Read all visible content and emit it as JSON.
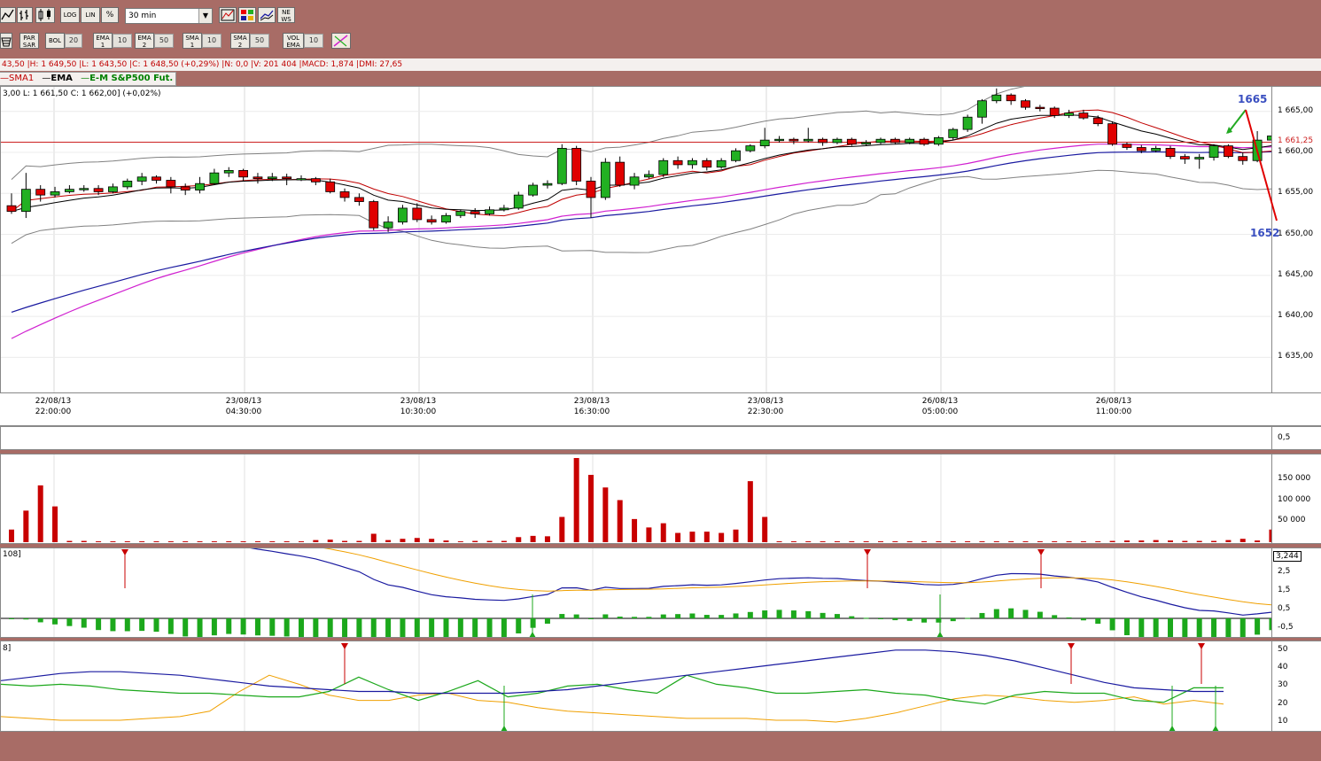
{
  "toolbar1": {
    "log_label": "LOG",
    "lin_label": "LIN",
    "pct_label": "%",
    "timeframe": "30 min",
    "news_label": "NE WS"
  },
  "toolbar2": {
    "parsar_label": "PAR SAR",
    "bol_label": "BOL",
    "bol_value": "20",
    "ema1_label": "EMA 1",
    "ema1_value": "10",
    "ema2_label": "EMA 2",
    "ema2_value": "50",
    "sma1_label": "SMA 1",
    "sma1_value": "10",
    "sma2_label": "SMA 2",
    "sma2_value": "50",
    "volema_label": "VOL EMA",
    "volema_value": "10"
  },
  "info_line": "43,50 |H: 1 649,50 |L: 1 643,50 |C: 1 648,50 (+0,29%) |N: 0,0 |V: 201 404 |MACD: 1,874 |DMI: 27,65",
  "legend": {
    "sma": "SMA1",
    "ema": "EMA",
    "instrument": "E-M S&P500 Fut."
  },
  "price_readout": "3,00  L: 1 661,50  C: 1 662,00] (+0,02%)",
  "current_price_label": "1 661,25",
  "annotations": {
    "target_up": "1665",
    "target_down": "1652"
  },
  "price_axis": [
    "1 665,00",
    "1 660,00",
    "1 655,00",
    "1 650,00",
    "1 645,00",
    "1 640,00",
    "1 635,00"
  ],
  "date_labels": [
    {
      "d": "22/08/13",
      "t": "22:00:00"
    },
    {
      "d": "23/08/13",
      "t": "04:30:00"
    },
    {
      "d": "23/08/13",
      "t": "10:30:00"
    },
    {
      "d": "23/08/13",
      "t": "16:30:00"
    },
    {
      "d": "23/08/13",
      "t": "22:30:00"
    },
    {
      "d": "26/08/13",
      "t": "05:00:00"
    },
    {
      "d": "26/08/13",
      "t": "11:00:00"
    }
  ],
  "blank_panel_axis": "0,5",
  "volume_axis": [
    "150 000",
    "100 000",
    "50 000"
  ],
  "macd_panel": {
    "label": "108]",
    "axis": [
      "2,5",
      "1,5",
      "0,5",
      "-0,5"
    ],
    "value_badge": "3,244"
  },
  "dmi_panel": {
    "label": "8]",
    "axis": [
      "50",
      "40",
      "30",
      "20",
      "10"
    ]
  },
  "colors": {
    "up_candle": "#22b022",
    "down_candle": "#e00000",
    "sma": "#c00000",
    "ema": "#000000",
    "sma_long": "#d020d0",
    "ema_long": "#1a1aa0",
    "bollinger": "#808080",
    "annotation": "#3a4fc0"
  },
  "chart_data": {
    "type": "candlestick",
    "ylim": [
      1630.5,
      1668
    ],
    "candles": [
      [
        1653.5,
        1652.8,
        1655.0,
        1652.5
      ],
      [
        1652.8,
        1655.5,
        1657.5,
        1652.0
      ],
      [
        1655.5,
        1654.8,
        1656.0,
        1654.0
      ],
      [
        1654.8,
        1655.2,
        1655.8,
        1654.5
      ],
      [
        1655.2,
        1655.5,
        1656.0,
        1655.0
      ],
      [
        1655.5,
        1655.6,
        1656.0,
        1655.2
      ],
      [
        1655.6,
        1655.2,
        1656.0,
        1654.8
      ],
      [
        1655.2,
        1655.8,
        1656.2,
        1655.0
      ],
      [
        1655.8,
        1656.5,
        1656.8,
        1655.5
      ],
      [
        1656.5,
        1657.0,
        1657.5,
        1656.0
      ],
      [
        1657.0,
        1656.6,
        1657.2,
        1656.2
      ],
      [
        1656.6,
        1655.8,
        1657.0,
        1655.0
      ],
      [
        1655.8,
        1655.4,
        1656.2,
        1654.8
      ],
      [
        1655.4,
        1656.2,
        1657.0,
        1655.0
      ],
      [
        1656.2,
        1657.5,
        1658.0,
        1656.0
      ],
      [
        1657.5,
        1657.8,
        1658.2,
        1657.0
      ],
      [
        1657.8,
        1657.0,
        1658.0,
        1656.5
      ],
      [
        1657.0,
        1656.8,
        1657.5,
        1656.2
      ],
      [
        1656.8,
        1657.0,
        1657.5,
        1656.5
      ],
      [
        1657.0,
        1656.8,
        1657.4,
        1656.0
      ],
      [
        1656.8,
        1656.8,
        1657.2,
        1656.5
      ],
      [
        1656.8,
        1656.4,
        1657.0,
        1656.0
      ],
      [
        1656.4,
        1655.2,
        1656.8,
        1655.0
      ],
      [
        1655.2,
        1654.5,
        1655.6,
        1654.0
      ],
      [
        1654.5,
        1654.0,
        1655.0,
        1653.5
      ],
      [
        1654.0,
        1650.8,
        1654.2,
        1650.5
      ],
      [
        1650.8,
        1651.5,
        1652.2,
        1650.3
      ],
      [
        1651.5,
        1653.2,
        1653.6,
        1651.2
      ],
      [
        1653.2,
        1651.8,
        1653.8,
        1651.5
      ],
      [
        1651.8,
        1651.5,
        1652.3,
        1651.2
      ],
      [
        1651.5,
        1652.3,
        1652.6,
        1651.3
      ],
      [
        1652.3,
        1652.8,
        1653.0,
        1652.0
      ],
      [
        1652.8,
        1652.5,
        1653.2,
        1652.0
      ],
      [
        1652.5,
        1653.0,
        1653.4,
        1652.3
      ],
      [
        1653.0,
        1653.2,
        1653.6,
        1652.8
      ],
      [
        1653.2,
        1654.8,
        1655.2,
        1653.0
      ],
      [
        1654.8,
        1656.0,
        1656.3,
        1654.6
      ],
      [
        1656.0,
        1656.2,
        1656.6,
        1655.6
      ],
      [
        1656.2,
        1660.5,
        1661.0,
        1656.0
      ],
      [
        1660.5,
        1656.5,
        1660.8,
        1656.0
      ],
      [
        1656.5,
        1654.5,
        1657.0,
        1652.0
      ],
      [
        1654.5,
        1658.8,
        1659.3,
        1654.2
      ],
      [
        1658.8,
        1656.0,
        1659.5,
        1655.8
      ],
      [
        1656.0,
        1657.0,
        1657.5,
        1655.5
      ],
      [
        1657.0,
        1657.3,
        1657.8,
        1656.8
      ],
      [
        1657.3,
        1659.0,
        1659.3,
        1657.0
      ],
      [
        1659.0,
        1658.5,
        1659.5,
        1658.0
      ],
      [
        1658.5,
        1659.0,
        1659.3,
        1658.0
      ],
      [
        1659.0,
        1658.2,
        1659.3,
        1657.8
      ],
      [
        1658.2,
        1659.0,
        1659.3,
        1658.0
      ],
      [
        1659.0,
        1660.2,
        1660.5,
        1658.8
      ],
      [
        1660.2,
        1660.8,
        1661.0,
        1660.0
      ],
      [
        1660.8,
        1661.5,
        1663.0,
        1660.5
      ],
      [
        1661.5,
        1661.6,
        1662.0,
        1661.2
      ],
      [
        1661.6,
        1661.4,
        1661.8,
        1661.0
      ],
      [
        1661.4,
        1661.6,
        1663.0,
        1661.2
      ],
      [
        1661.6,
        1661.2,
        1661.8,
        1660.8
      ],
      [
        1661.2,
        1661.6,
        1661.8,
        1661.0
      ],
      [
        1661.6,
        1661.0,
        1661.8,
        1660.8
      ],
      [
        1661.0,
        1661.2,
        1661.5,
        1660.8
      ],
      [
        1661.2,
        1661.6,
        1661.8,
        1661.0
      ],
      [
        1661.6,
        1661.2,
        1661.8,
        1661.0
      ],
      [
        1661.2,
        1661.6,
        1661.8,
        1661.0
      ],
      [
        1661.6,
        1661.0,
        1661.8,
        1660.8
      ],
      [
        1661.0,
        1661.8,
        1662.0,
        1660.8
      ],
      [
        1661.8,
        1662.8,
        1663.0,
        1661.5
      ],
      [
        1662.8,
        1664.3,
        1664.6,
        1662.5
      ],
      [
        1664.3,
        1666.3,
        1666.5,
        1663.5
      ],
      [
        1666.3,
        1667.0,
        1667.8,
        1666.0
      ],
      [
        1667.0,
        1666.3,
        1667.2,
        1665.8
      ],
      [
        1666.3,
        1665.5,
        1666.5,
        1665.2
      ],
      [
        1665.5,
        1665.4,
        1665.8,
        1665.0
      ],
      [
        1665.4,
        1664.5,
        1665.6,
        1664.2
      ],
      [
        1664.5,
        1664.8,
        1665.2,
        1664.2
      ],
      [
        1664.8,
        1664.2,
        1665.2,
        1664.0
      ],
      [
        1664.2,
        1663.5,
        1664.5,
        1663.2
      ],
      [
        1663.5,
        1661.0,
        1663.8,
        1660.8
      ],
      [
        1661.0,
        1660.6,
        1661.2,
        1660.3
      ],
      [
        1660.6,
        1660.2,
        1660.9,
        1659.9
      ],
      [
        1660.2,
        1660.5,
        1660.8,
        1660.0
      ],
      [
        1660.5,
        1659.5,
        1660.8,
        1659.2
      ],
      [
        1659.5,
        1659.2,
        1659.8,
        1658.6
      ],
      [
        1659.2,
        1659.4,
        1659.8,
        1658.0
      ],
      [
        1659.4,
        1660.8,
        1661.0,
        1659.0
      ],
      [
        1660.8,
        1659.5,
        1661.0,
        1659.3
      ],
      [
        1659.5,
        1659.0,
        1660.0,
        1658.5
      ],
      [
        1659.0,
        1661.5,
        1662.6,
        1658.8
      ],
      [
        1661.5,
        1662.0,
        1662.5,
        1661.5
      ]
    ],
    "volume": [
      30000,
      75000,
      135000,
      85000,
      3000,
      3000,
      2000,
      2000,
      2000,
      2000,
      2000,
      2000,
      2000,
      2000,
      2000,
      2000,
      2000,
      2000,
      2000,
      2000,
      2000,
      5000,
      6000,
      3000,
      3000,
      20000,
      5000,
      8000,
      10000,
      8000,
      4000,
      2000,
      3000,
      3000,
      3000,
      12000,
      15000,
      14000,
      60000,
      200000,
      160000,
      130000,
      100000,
      55000,
      35000,
      45000,
      22000,
      25000,
      25000,
      22000,
      30000,
      145000,
      60000,
      2000,
      2000,
      2000,
      2000,
      2000,
      2000,
      2000,
      2000,
      2000,
      2000,
      2000,
      2000,
      2000,
      2000,
      2000,
      2000,
      2000,
      2000,
      2000,
      2000,
      2000,
      2000,
      2000,
      3000,
      4000,
      4000,
      5000,
      4000,
      3000,
      3000,
      3000,
      5000,
      8000,
      4000,
      30000,
      15000
    ]
  }
}
